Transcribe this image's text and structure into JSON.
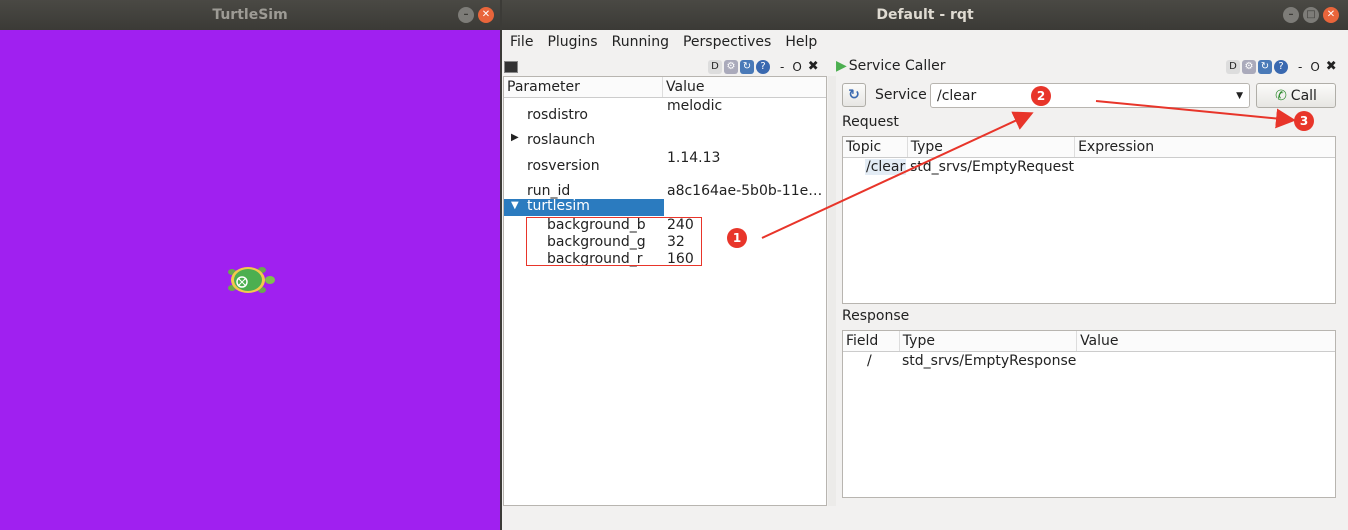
{
  "turtlesim": {
    "title": "TurtleSim",
    "bg_color": "#a020f0"
  },
  "rqt": {
    "title": "Default - rqt",
    "menu": [
      "File",
      "Plugins",
      "Running",
      "Perspectives",
      "Help"
    ],
    "param_panel": {
      "col_parameter": "Parameter",
      "col_value": "Value",
      "rows": [
        {
          "name": "rosdistro",
          "value": "melodic"
        },
        {
          "name": "roslaunch",
          "value": ""
        },
        {
          "name": "rosversion",
          "value": "1.14.13"
        },
        {
          "name": "run_id",
          "value": "a8c164ae-5b0b-11e…"
        },
        {
          "name": "turtlesim",
          "value": ""
        },
        {
          "name": "background_b",
          "value": "240"
        },
        {
          "name": "background_g",
          "value": "32"
        },
        {
          "name": "background_r",
          "value": "160"
        }
      ]
    },
    "service_caller": {
      "title": "Service Caller",
      "service_label": "Service",
      "service_value": "/clear",
      "call_label": "Call",
      "request_label": "Request",
      "request_cols": [
        "Topic",
        "Type",
        "Expression"
      ],
      "request_row": {
        "topic": "/clear",
        "type": "std_srvs/EmptyRequest"
      },
      "response_label": "Response",
      "response_cols": [
        "Field",
        "Type",
        "Value"
      ],
      "response_row": {
        "field": "/",
        "type": "std_srvs/EmptyResponse"
      }
    },
    "annotations": [
      "1",
      "2",
      "3"
    ]
  }
}
